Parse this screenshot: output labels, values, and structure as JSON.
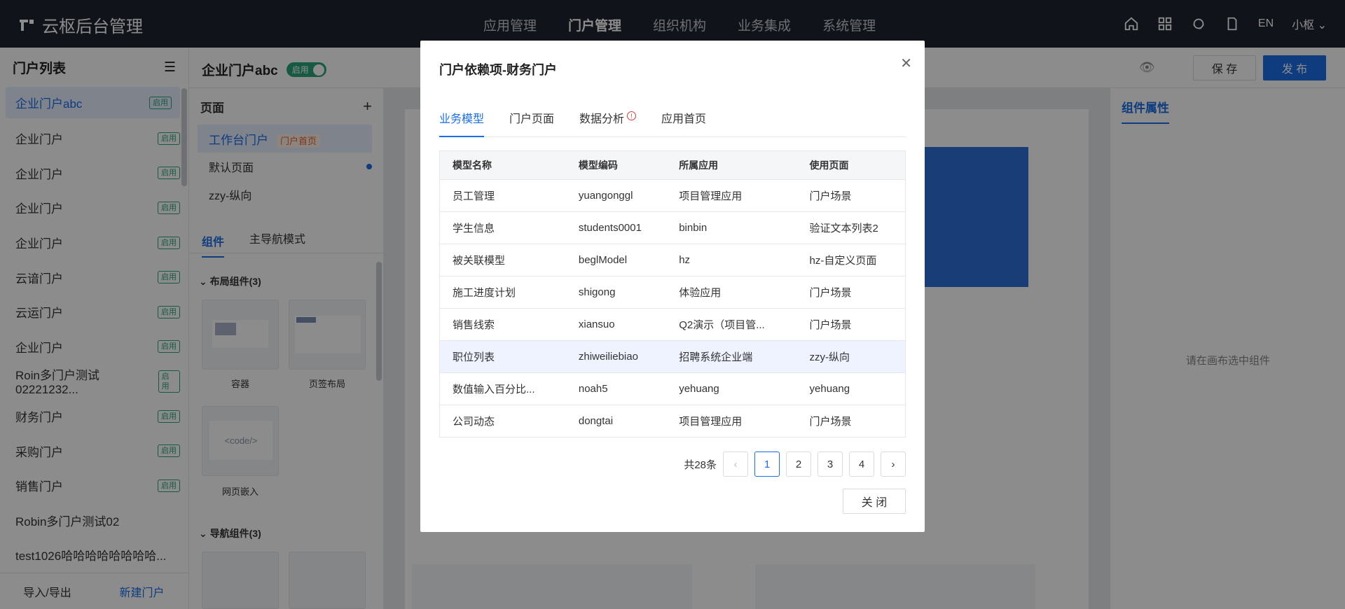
{
  "app": {
    "title": "云枢后台管理"
  },
  "topnav": [
    "应用管理",
    "门户管理",
    "组织机构",
    "业务集成",
    "系统管理"
  ],
  "topnav_active": 1,
  "topright": {
    "lang": "EN",
    "user": "小枢"
  },
  "sidebar": {
    "title": "门户列表",
    "items": [
      {
        "label": "企业门户abc",
        "badge": "启用"
      },
      {
        "label": "企业门户",
        "badge": "启用"
      },
      {
        "label": "企业门户",
        "badge": "启用"
      },
      {
        "label": "企业门户",
        "badge": "启用"
      },
      {
        "label": "企业门户",
        "badge": "启用"
      },
      {
        "label": "云谙门户",
        "badge": "启用"
      },
      {
        "label": "云运门户",
        "badge": "启用"
      },
      {
        "label": "企业门户",
        "badge": "启用"
      },
      {
        "label": "Roin多门户测试02221232...",
        "badge": "启用"
      },
      {
        "label": "财务门户",
        "badge": "启用"
      },
      {
        "label": "采购门户",
        "badge": "启用"
      },
      {
        "label": "销售门户",
        "badge": "启用"
      },
      {
        "label": "Robin多门户测试02",
        "badge": ""
      },
      {
        "label": "test1026哈哈哈哈哈哈哈哈...",
        "badge": ""
      }
    ],
    "foot_import": "导入/导出",
    "foot_new": "新建门户"
  },
  "subheader": {
    "title": "企业门户abc",
    "status": "启用",
    "save": "保 存",
    "publish": "发 布"
  },
  "pages": {
    "title": "页面",
    "items": [
      {
        "label": "工作台门户",
        "tag": "门户首页"
      },
      {
        "label": "默认页面",
        "tag": ""
      },
      {
        "label": "zzy-纵向",
        "tag": ""
      }
    ],
    "tabs": [
      "组件",
      "主导航模式"
    ],
    "group1": "布局组件(3)",
    "group2": "导航组件(3)",
    "comp1": "容器",
    "comp2": "页签布局",
    "comp3": "网页嵌入",
    "code": "<code/>"
  },
  "right": {
    "tab": "组件属性",
    "empty": "请在画布选中组件"
  },
  "modal": {
    "title": "门户依赖项-财务门户",
    "tabs": [
      "业务模型",
      "门户页面",
      "数据分析",
      "应用首页"
    ],
    "columns": [
      "模型名称",
      "模型编码",
      "所属应用",
      "使用页面"
    ],
    "rows": [
      [
        "员工管理",
        "yuangonggl",
        "项目管理应用",
        "门户场景"
      ],
      [
        "学生信息",
        "students0001",
        "binbin",
        "验证文本列表2"
      ],
      [
        "被关联模型",
        "beglModel",
        "hz",
        "hz-自定义页面"
      ],
      [
        "施工进度计划",
        "shigong",
        "体验应用",
        "门户场景"
      ],
      [
        "销售线索",
        "xiansuo",
        "Q2演示（项目管...",
        "门户场景"
      ],
      [
        "职位列表",
        "zhiweiliebiao",
        "招聘系统企业端",
        "zzy-纵向"
      ],
      [
        "数值输入百分比...",
        "noah5",
        "yehuang",
        "yehuang"
      ],
      [
        "公司动态",
        "dongtai",
        "项目管理应用",
        "门户场景"
      ]
    ],
    "total": "共28条",
    "pages": [
      "1",
      "2",
      "3",
      "4"
    ],
    "close_btn": "关 闭"
  }
}
